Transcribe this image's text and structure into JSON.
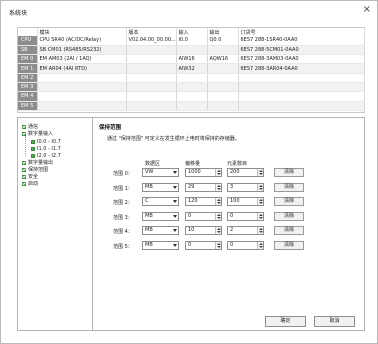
{
  "window": {
    "title": "系统块",
    "close_glyph": "×"
  },
  "modules": {
    "headers": [
      "",
      "模块",
      "版本",
      "输入",
      "输出",
      "订货号"
    ],
    "rows": [
      {
        "slot": "CPU",
        "module": "CPU SR40 (AC/DC/Relay)",
        "version": "V02.04.00_00.00...",
        "input": "I0.0",
        "output": "Q0.0",
        "order": "6ES7 288-1SR40-0AA0"
      },
      {
        "slot": "SB",
        "module": "SB CM01 (RS485/RS232)",
        "version": "",
        "input": "",
        "output": "",
        "order": "6ES7 288-5CM01-0AA0"
      },
      {
        "slot": "EM 0",
        "module": "EM AM03 (2AI / 1AQ)",
        "version": "",
        "input": "AIW16",
        "output": "AQW16",
        "order": "6ES7 288-3AM03-0AA0"
      },
      {
        "slot": "EM 1",
        "module": "EM AR04 (4AI RTD)",
        "version": "",
        "input": "AIW32",
        "output": "",
        "order": "6ES7 288-3AR04-0AA0"
      },
      {
        "slot": "EM 2",
        "module": "",
        "version": "",
        "input": "",
        "output": "",
        "order": ""
      },
      {
        "slot": "EM 3",
        "module": "",
        "version": "",
        "input": "",
        "output": "",
        "order": ""
      },
      {
        "slot": "EM 4",
        "module": "",
        "version": "",
        "input": "",
        "output": "",
        "order": ""
      },
      {
        "slot": "EM 5",
        "module": "",
        "version": "",
        "input": "",
        "output": "",
        "order": ""
      }
    ]
  },
  "tree": {
    "items": [
      {
        "label": "通信",
        "kind": "check"
      },
      {
        "label": "数字量输入",
        "kind": "check"
      },
      {
        "label": "I0.0 - I0.7",
        "kind": "square"
      },
      {
        "label": "I1.0 - I1.7",
        "kind": "square"
      },
      {
        "label": "I2.0 - I2.7",
        "kind": "square"
      },
      {
        "label": "数字量输出",
        "kind": "check"
      },
      {
        "label": "保持范围",
        "kind": "check"
      },
      {
        "label": "安全",
        "kind": "check"
      },
      {
        "label": "启动",
        "kind": "check"
      }
    ]
  },
  "retain": {
    "section_title": "保持范围",
    "description": "通过 \"保持范围\" 可定义在发生循环上电时将保持的存储器。",
    "col_data_area": "数据区",
    "col_offset": "偏移量",
    "col_count": "元素数目",
    "clear_label": "清除",
    "ranges": [
      {
        "label": "范围 0：",
        "area": "VW",
        "offset": "1000",
        "count": "200"
      },
      {
        "label": "范围 1：",
        "area": "MB",
        "offset": "29",
        "count": "3"
      },
      {
        "label": "范围 2：",
        "area": "C",
        "offset": "120",
        "count": "100"
      },
      {
        "label": "范围 3：",
        "area": "MB",
        "offset": "0",
        "count": "0"
      },
      {
        "label": "范围 4：",
        "area": "MB",
        "offset": "10",
        "count": "2"
      },
      {
        "label": "范围 5：",
        "area": "MB",
        "offset": "0",
        "count": "0"
      }
    ]
  },
  "footer": {
    "ok_label": "确定",
    "cancel_label": "取消"
  }
}
